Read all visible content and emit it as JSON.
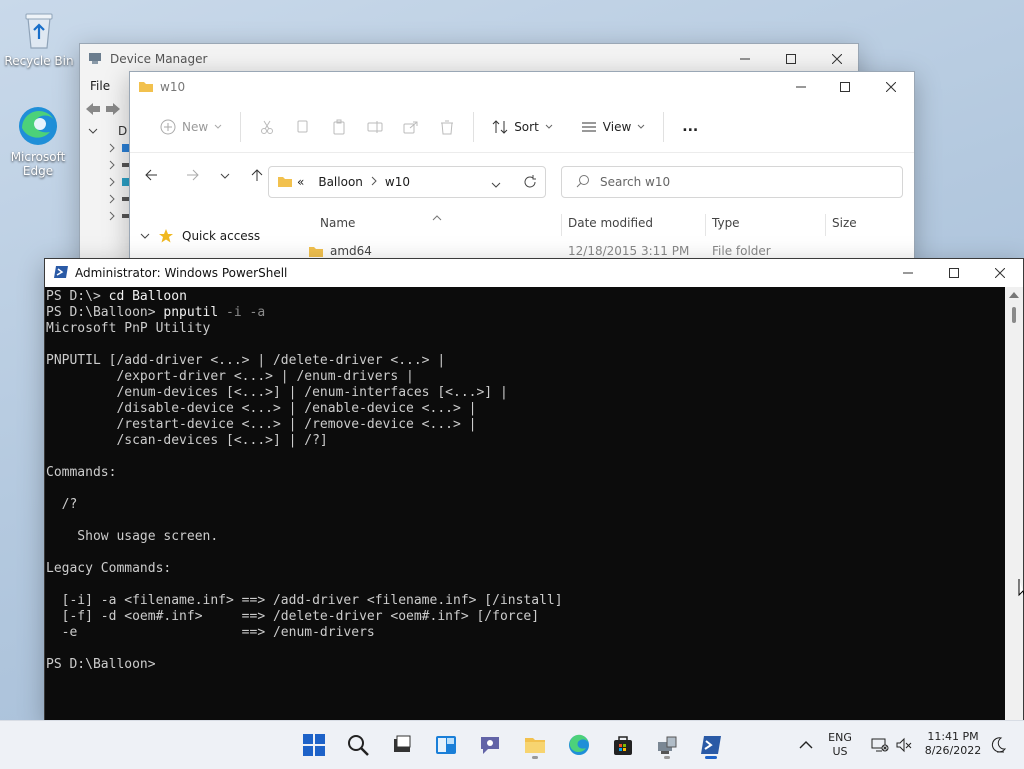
{
  "desktop": {
    "icons": [
      {
        "label": "Recycle Bin"
      },
      {
        "label": "Microsoft Edge"
      }
    ]
  },
  "device_manager": {
    "title": "Device Manager",
    "menu": [
      "File"
    ],
    "tree_root_label": "D"
  },
  "explorer": {
    "title": "w10",
    "commands": {
      "new": "New",
      "sort": "Sort",
      "view": "View",
      "more": "..."
    },
    "address": {
      "overflow": "«",
      "crumbs": [
        "Balloon",
        "w10"
      ]
    },
    "search_placeholder": "Search w10",
    "nav": {
      "quick_access": "Quick access"
    },
    "columns": {
      "name": "Name",
      "date": "Date modified",
      "type": "Type",
      "size": "Size"
    },
    "rows": [
      {
        "name": "amd64",
        "date": "12/18/2015 3:11 PM",
        "type": "File folder"
      }
    ]
  },
  "powershell": {
    "title": "Administrator: Windows PowerShell",
    "lines": [
      {
        "text": "PS D:\\> ",
        "cmd": "cd Balloon",
        "args": ""
      },
      {
        "text": "PS D:\\Balloon> ",
        "cmd": "pnputil",
        "args": " -i -a"
      },
      {
        "text": "Microsoft PnP Utility",
        "cmd": "",
        "args": ""
      },
      {
        "text": "",
        "cmd": "",
        "args": ""
      },
      {
        "text": "PNPUTIL [/add-driver <...> | /delete-driver <...> |",
        "cmd": "",
        "args": ""
      },
      {
        "text": "         /export-driver <...> | /enum-drivers |",
        "cmd": "",
        "args": ""
      },
      {
        "text": "         /enum-devices [<...>] | /enum-interfaces [<...>] |",
        "cmd": "",
        "args": ""
      },
      {
        "text": "         /disable-device <...> | /enable-device <...> |",
        "cmd": "",
        "args": ""
      },
      {
        "text": "         /restart-device <...> | /remove-device <...> |",
        "cmd": "",
        "args": ""
      },
      {
        "text": "         /scan-devices [<...>] | /?]",
        "cmd": "",
        "args": ""
      },
      {
        "text": "",
        "cmd": "",
        "args": ""
      },
      {
        "text": "Commands:",
        "cmd": "",
        "args": ""
      },
      {
        "text": "",
        "cmd": "",
        "args": ""
      },
      {
        "text": "  /?",
        "cmd": "",
        "args": ""
      },
      {
        "text": "",
        "cmd": "",
        "args": ""
      },
      {
        "text": "    Show usage screen.",
        "cmd": "",
        "args": ""
      },
      {
        "text": "",
        "cmd": "",
        "args": ""
      },
      {
        "text": "Legacy Commands:",
        "cmd": "",
        "args": ""
      },
      {
        "text": "",
        "cmd": "",
        "args": ""
      },
      {
        "text": "  [-i] -a <filename.inf> ==> /add-driver <filename.inf> [/install]",
        "cmd": "",
        "args": ""
      },
      {
        "text": "  [-f] -d <oem#.inf>     ==> /delete-driver <oem#.inf> [/force]",
        "cmd": "",
        "args": ""
      },
      {
        "text": "  -e                     ==> /enum-drivers",
        "cmd": "",
        "args": ""
      },
      {
        "text": "",
        "cmd": "",
        "args": ""
      },
      {
        "text": "PS D:\\Balloon> ",
        "cmd": "",
        "args": ""
      }
    ]
  },
  "taskbar": {
    "lang": {
      "line1": "ENG",
      "line2": "US"
    },
    "clock": {
      "time": "11:41 PM",
      "date": "8/26/2022"
    }
  },
  "colors": {
    "ps_bg": "#0c0c0c",
    "ps_text": "#cccccc",
    "accent": "#1d62c8"
  }
}
